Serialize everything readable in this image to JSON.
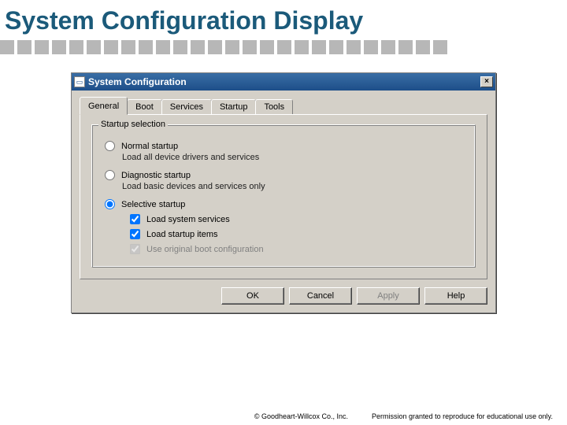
{
  "slide": {
    "title": "System Configuration Display"
  },
  "window": {
    "title": "System Configuration",
    "close_glyph": "×",
    "tabs": [
      {
        "label": "General"
      },
      {
        "label": "Boot"
      },
      {
        "label": "Services"
      },
      {
        "label": "Startup"
      },
      {
        "label": "Tools"
      }
    ],
    "group": {
      "legend": "Startup selection",
      "radios": [
        {
          "label": "Normal startup",
          "desc": "Load all device drivers and services"
        },
        {
          "label": "Diagnostic startup",
          "desc": "Load basic devices and services only"
        },
        {
          "label": "Selective startup"
        }
      ],
      "checks": [
        {
          "label": "Load system services"
        },
        {
          "label": "Load startup items"
        },
        {
          "label": "Use original boot configuration"
        }
      ]
    },
    "buttons": {
      "ok": "OK",
      "cancel": "Cancel",
      "apply": "Apply",
      "help": "Help"
    }
  },
  "footer": {
    "copyright": "© Goodheart-Willcox Co., Inc.",
    "permission": "Permission granted to reproduce for educational use only."
  }
}
